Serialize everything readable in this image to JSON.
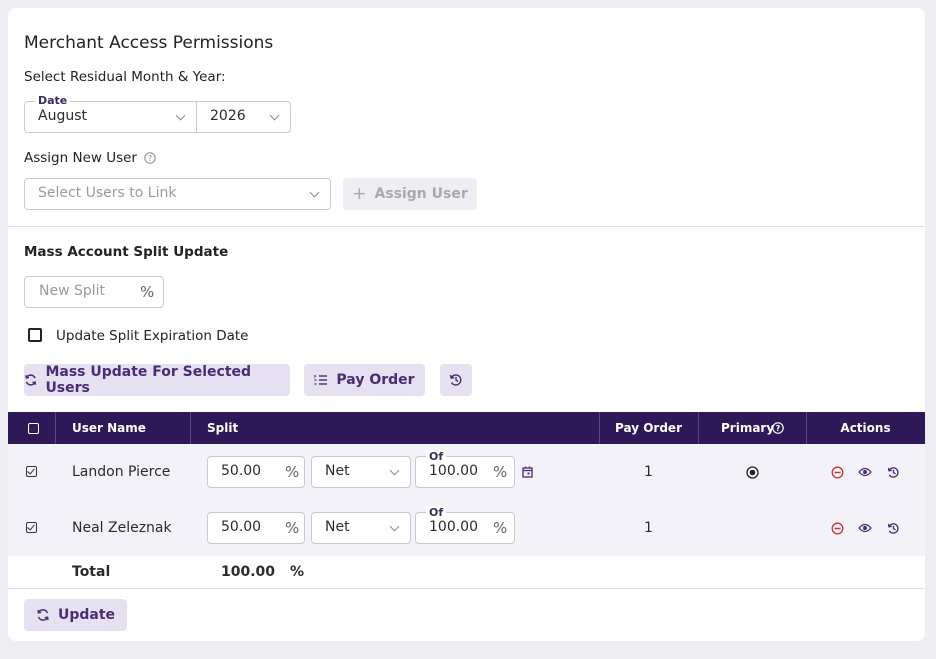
{
  "page": {
    "title": "Merchant Access Permissions",
    "residual_label": "Select Residual Month & Year:",
    "date_legend": "Date",
    "month": "August",
    "year": "2026",
    "assign_label": "Assign New User",
    "users_placeholder": "Select Users to Link",
    "assign_button": "Assign User",
    "mass_title": "Mass Account Split Update",
    "new_split_placeholder": "New Split",
    "pct": "%",
    "expiration_label": "Update Split Expiration Date",
    "mass_update_button": "Mass Update For Selected Users",
    "pay_order_button": "Pay Order",
    "update_button": "Update"
  },
  "table": {
    "headers": {
      "user_name": "User Name",
      "split": "Split",
      "pay_order": "Pay Order",
      "primary": "Primary",
      "actions": "Actions"
    },
    "rows": [
      {
        "name": "Landon Pierce",
        "split": "50.00",
        "pct": "%",
        "basis": "Net",
        "of_label": "Of",
        "of_value": "100.00",
        "pay_order": "1",
        "primary": true,
        "selected": true
      },
      {
        "name": "Neal Zeleznak",
        "split": "50.00",
        "pct": "%",
        "basis": "Net",
        "of_label": "Of",
        "of_value": "100.00",
        "pay_order": "1",
        "primary": false,
        "selected": true
      }
    ],
    "total": {
      "label": "Total",
      "value": "100.00",
      "pct": "%"
    }
  },
  "colors": {
    "header_bg": "#2f1857",
    "button_bg": "#e6e1f0",
    "button_text": "#4b2a7a",
    "remove_icon": "#d32f2f",
    "row_bg": "#f3f2f9"
  },
  "icons": [
    "help-icon",
    "plus-icon",
    "refresh-icon",
    "list-icon",
    "history-icon",
    "calendar-icon",
    "remove-icon",
    "eye-icon",
    "radio-selected-icon",
    "checkbox-checked-icon",
    "chevron-down-icon"
  ]
}
